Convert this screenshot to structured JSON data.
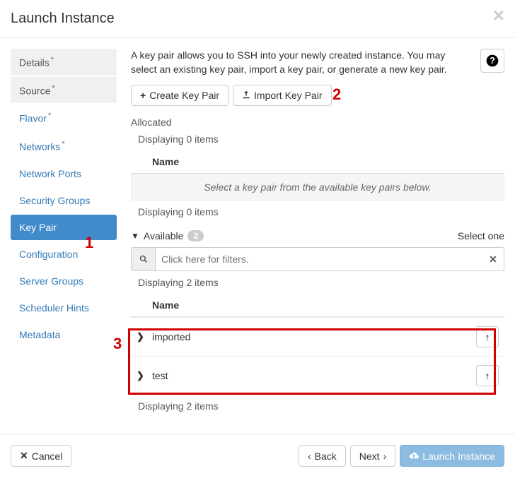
{
  "header": {
    "title": "Launch Instance"
  },
  "sidebar": {
    "items": [
      {
        "label": "Details",
        "required": true,
        "state": "muted"
      },
      {
        "label": "Source",
        "required": true,
        "state": "muted"
      },
      {
        "label": "Flavor",
        "required": true,
        "state": ""
      },
      {
        "label": "Networks",
        "required": true,
        "state": ""
      },
      {
        "label": "Network Ports",
        "required": false,
        "state": ""
      },
      {
        "label": "Security Groups",
        "required": false,
        "state": ""
      },
      {
        "label": "Key Pair",
        "required": false,
        "state": "active"
      },
      {
        "label": "Configuration",
        "required": false,
        "state": ""
      },
      {
        "label": "Server Groups",
        "required": false,
        "state": ""
      },
      {
        "label": "Scheduler Hints",
        "required": false,
        "state": ""
      },
      {
        "label": "Metadata",
        "required": false,
        "state": ""
      }
    ]
  },
  "main": {
    "description": "A key pair allows you to SSH into your newly created instance. You may select an existing key pair, import a key pair, or generate a new key pair.",
    "create_btn": "Create Key Pair",
    "import_btn": "Import Key Pair",
    "allocated_label": "Allocated",
    "allocated_displaying": "Displaying 0 items",
    "name_col": "Name",
    "empty_msg": "Select a key pair from the available key pairs below.",
    "available_label": "Available",
    "available_count": "2",
    "select_one": "Select one",
    "filter_placeholder": "Click here for filters.",
    "available_displaying": "Displaying 2 items",
    "items": [
      {
        "name": "imported"
      },
      {
        "name": "test"
      }
    ]
  },
  "footer": {
    "cancel": "Cancel",
    "back": "Back",
    "next": "Next",
    "launch": "Launch Instance"
  },
  "annotations": {
    "a1": "1",
    "a2": "2",
    "a3": "3"
  }
}
